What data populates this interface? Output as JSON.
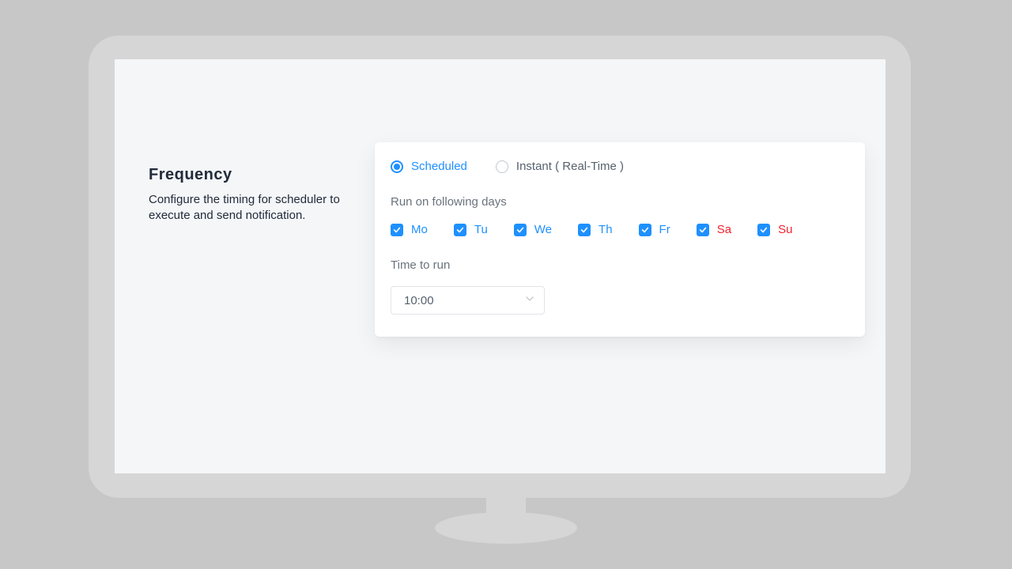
{
  "header": {
    "title": "Frequency",
    "description": "Configure the timing for scheduler to execute and send notification."
  },
  "modeOptions": {
    "scheduled": "Scheduled",
    "instant": "Instant ( Real-Time )"
  },
  "selectedMode": "scheduled",
  "daysLabel": "Run on following days",
  "days": [
    {
      "label": "Mo",
      "checked": true,
      "weekend": false
    },
    {
      "label": "Tu",
      "checked": true,
      "weekend": false
    },
    {
      "label": "We",
      "checked": true,
      "weekend": false
    },
    {
      "label": "Th",
      "checked": true,
      "weekend": false
    },
    {
      "label": "Fr",
      "checked": true,
      "weekend": false
    },
    {
      "label": "Sa",
      "checked": true,
      "weekend": true
    },
    {
      "label": "Su",
      "checked": true,
      "weekend": true
    }
  ],
  "timeLabel": "Time to run",
  "timeValue": "10:00",
  "colors": {
    "accent": "#1e90ff",
    "danger": "#f5222d"
  }
}
